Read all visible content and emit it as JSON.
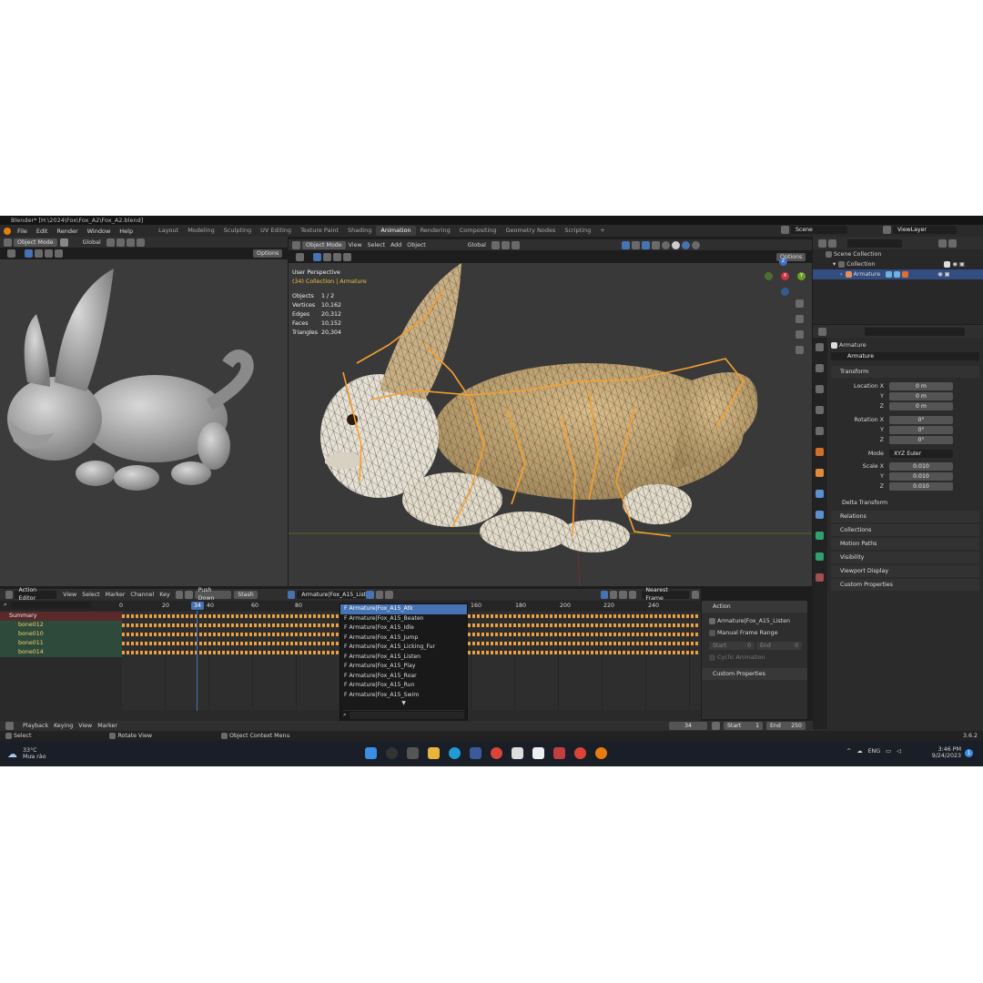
{
  "window": {
    "title": "Blender* [H:\\2024\\Fox\\Fox_A2\\Fox_A2.blend]"
  },
  "menus": [
    "File",
    "Edit",
    "Render",
    "Window",
    "Help"
  ],
  "workspaces": [
    "Layout",
    "Modeling",
    "Sculpting",
    "UV Editing",
    "Texture Paint",
    "Shading",
    "Animation",
    "Rendering",
    "Compositing",
    "Geometry Nodes",
    "Scripting"
  ],
  "active_workspace": "Animation",
  "scene": {
    "name": "Scene",
    "view_layer": "ViewLayer"
  },
  "left_viewport": {
    "mode": "Object Mode",
    "transform": "Global",
    "options": "Options"
  },
  "main_viewport": {
    "mode": "Object Mode",
    "menu": [
      "View",
      "Select",
      "Add",
      "Object"
    ],
    "transform": "Global",
    "options": "Options",
    "perspective": "User Perspective",
    "collection": "(34) Collection | Armature",
    "stats": [
      {
        "label": "Objects",
        "value": "1 / 2"
      },
      {
        "label": "Vertices",
        "value": "10,162"
      },
      {
        "label": "Edges",
        "value": "20,312"
      },
      {
        "label": "Faces",
        "value": "10,152"
      },
      {
        "label": "Triangles",
        "value": "20,304"
      }
    ],
    "gizmo": {
      "z": "Z",
      "y": "Y",
      "x": "X"
    }
  },
  "outliner": {
    "items": [
      {
        "label": "Scene Collection"
      },
      {
        "label": "Collection"
      },
      {
        "label": "Armature"
      }
    ]
  },
  "properties": {
    "object_name": "Armature",
    "object_field": "Armature",
    "transform_title": "Transform",
    "location": {
      "label": "Location X",
      "x": "0 m",
      "y": "0 m",
      "z": "0 m"
    },
    "rotation": {
      "label": "Rotation X",
      "x": "0°",
      "y": "0°",
      "z": "0°"
    },
    "mode_label": "Mode",
    "mode_value": "XYZ Euler",
    "scale": {
      "label": "Scale X",
      "x": "0.010",
      "y": "0.010",
      "z": "0.010"
    },
    "axis": {
      "y": "Y",
      "z": "Z"
    },
    "panels": [
      "Delta Transform",
      "Relations",
      "Collections",
      "Motion Paths",
      "Visibility",
      "Viewport Display",
      "Custom Properties"
    ]
  },
  "dopesheet": {
    "editor": "Action Editor",
    "menu": [
      "View",
      "Select",
      "Marker",
      "Channel",
      "Key"
    ],
    "push_down": "Push Down",
    "stash": "Stash",
    "action": "Armature|Fox_A15_Listen",
    "snap": "Nearest Frame",
    "current_frame": "34",
    "ruler": [
      "0",
      "20",
      "40",
      "60",
      "80",
      "160",
      "180",
      "200",
      "220",
      "240"
    ],
    "channels": [
      "Summary",
      "bone012",
      "bone010",
      "bone011",
      "bone014"
    ]
  },
  "action_dropdown": {
    "items": [
      "F Armature|Fox_A15_Atk",
      "F Armature|Fox_A15_Beaten",
      "F Armature|Fox_A15_Idle",
      "F Armature|Fox_A15_Jump",
      "F Armature|Fox_A15_Licking_Fur",
      "F Armature|Fox_A15_Listen",
      "F Armature|Fox_A15_Play",
      "F Armature|Fox_A15_Roar",
      "F Armature|Fox_A15_Run",
      "F Armature|Fox_A15_Swim"
    ],
    "selected_index": 0
  },
  "action_sidebar": {
    "title": "Action",
    "action_name": "Armature|Fox_A15_Listen",
    "manual_range": "Manual Frame Range",
    "start_label": "Start",
    "start_value": "0",
    "end_label": "End",
    "end_value": "0",
    "cyclic": "Cyclic Animation",
    "custom_props": "Custom Properties"
  },
  "timeline": {
    "menu": [
      "Playback",
      "Keying",
      "View",
      "Marker"
    ],
    "frame": "34",
    "start_label": "Start",
    "start": "1",
    "end_label": "End",
    "end": "250"
  },
  "statusbar": {
    "select": "Select",
    "rotate": "Rotate View",
    "context": "Object Context Menu",
    "version": "3.6.2"
  },
  "taskbar": {
    "weather_temp": "33°C",
    "weather_desc": "Mưa rào",
    "lang": "ENG",
    "time": "3:46 PM",
    "date": "9/24/2023",
    "notif": "1"
  },
  "colors": {
    "accent": "#4772b3",
    "keyframe": "#e8a040",
    "bone": "#f5a030",
    "fur": "#c9aa78"
  }
}
